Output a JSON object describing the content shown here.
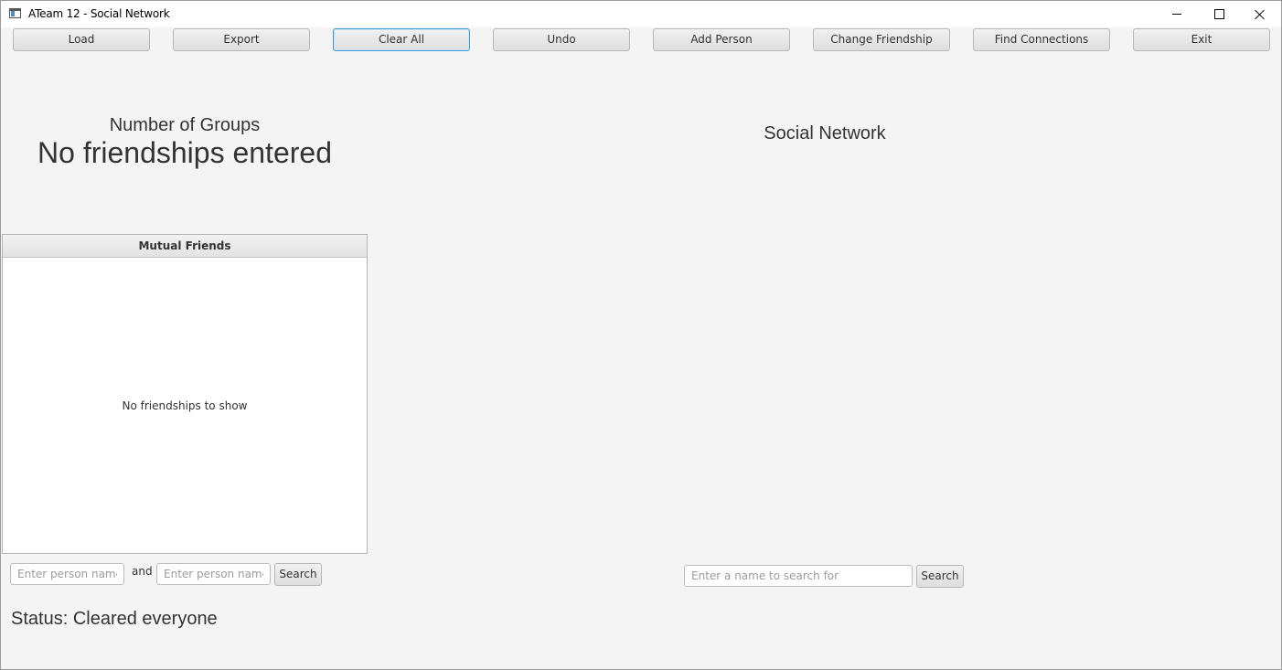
{
  "window": {
    "title": "ATeam 12 - Social Network"
  },
  "toolbar": {
    "buttons": [
      {
        "label": "Load"
      },
      {
        "label": "Export"
      },
      {
        "label": "Clear All"
      },
      {
        "label": "Undo"
      },
      {
        "label": "Add Person"
      },
      {
        "label": "Change Friendship"
      },
      {
        "label": "Find Connections"
      },
      {
        "label": "Exit"
      }
    ]
  },
  "groups": {
    "title": "Number of Groups",
    "value": "No friendships entered"
  },
  "network": {
    "title": "Social Network",
    "search_placeholder": "Enter a name to search for",
    "search_label": "Search"
  },
  "mutual": {
    "header": "Mutual Friends",
    "empty_text": "No friendships to show",
    "person1_placeholder": "Enter person name",
    "and_label": "and",
    "person2_placeholder": "Enter person name",
    "search_label": "Search"
  },
  "status": {
    "text": "Status: Cleared everyone"
  },
  "icons": {
    "app": "app-window-icon",
    "minimize": "minimize-icon",
    "maximize": "maximize-icon",
    "close": "close-icon"
  },
  "colors": {
    "focus_border": "#3a9ad9",
    "background": "#f4f4f4"
  }
}
